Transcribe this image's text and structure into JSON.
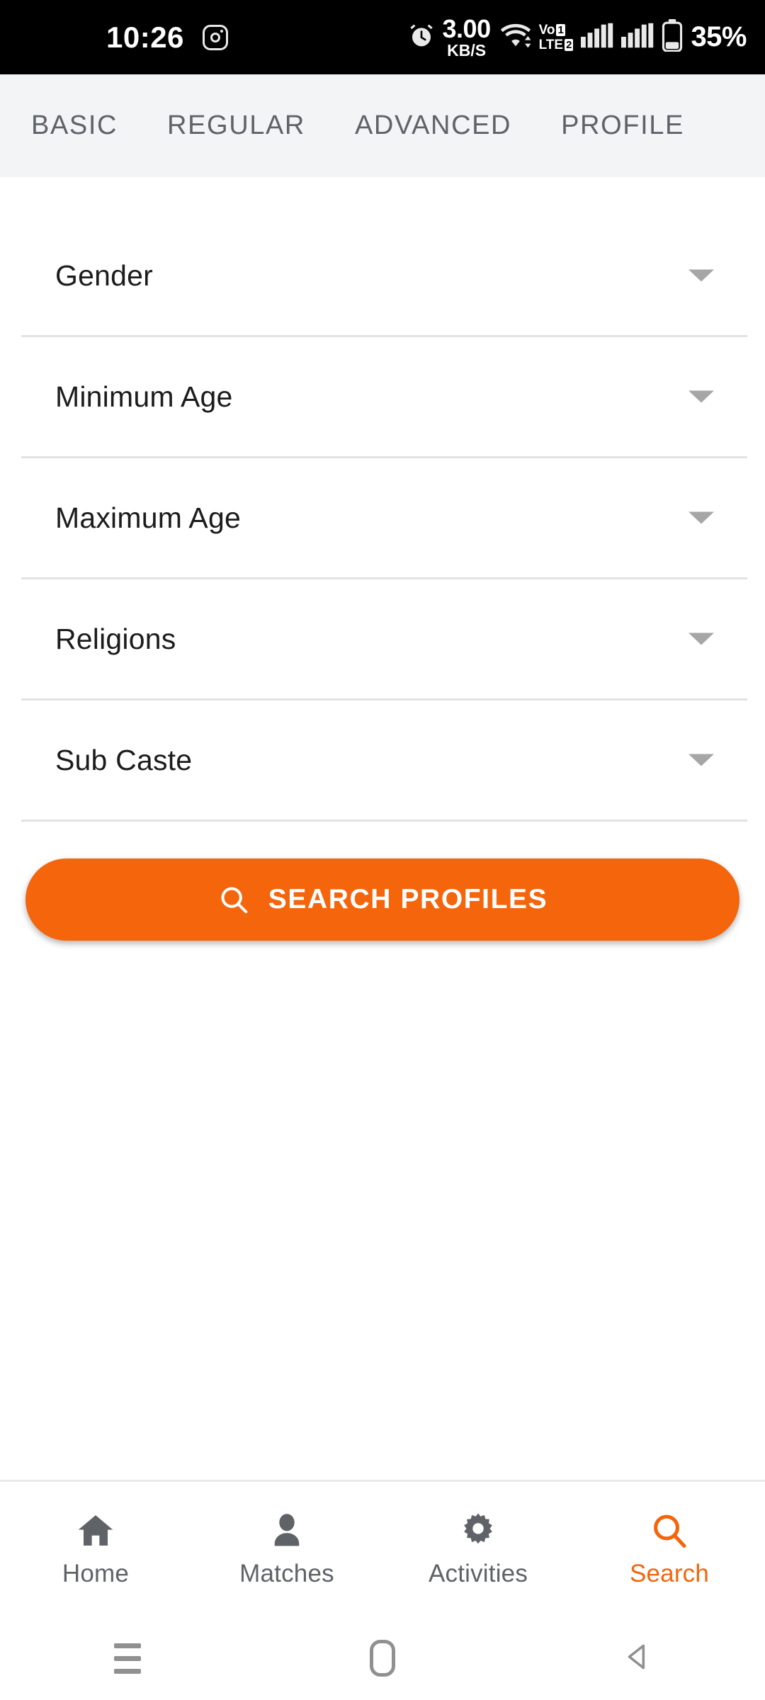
{
  "status_bar": {
    "time": "10:26",
    "app_icon": "instagram-icon",
    "alarm_icon": "alarm-clock-icon",
    "network_speed": "3.00",
    "network_speed_unit": "KB/S",
    "wifi_icon": "wifi-icon",
    "volte_label_top": "Vo",
    "volte_label_bottom": "LTE",
    "volte_sim1": "1",
    "volte_sim2": "2",
    "signal_icon": "cellular-signal-icon",
    "battery_icon": "battery-icon",
    "battery_level": "35%"
  },
  "tabs": [
    {
      "label": "BASIC",
      "active": true
    },
    {
      "label": "REGULAR",
      "active": false
    },
    {
      "label": "ADVANCED",
      "active": false
    },
    {
      "label": "PROFILE",
      "active": false
    }
  ],
  "form": {
    "fields": [
      {
        "label": "Gender",
        "value": "",
        "arrow_icon": "chevron-down-icon"
      },
      {
        "label": "Minimum Age",
        "value": "",
        "arrow_icon": "chevron-down-icon"
      },
      {
        "label": "Maximum Age",
        "value": "",
        "arrow_icon": "chevron-down-icon"
      },
      {
        "label": "Religions",
        "value": "",
        "arrow_icon": "chevron-down-icon"
      },
      {
        "label": "Sub Caste",
        "value": "",
        "arrow_icon": "chevron-down-icon"
      }
    ]
  },
  "search_button": {
    "label": "SEARCH PROFILES",
    "icon": "search-icon",
    "background_color": "#f4650c",
    "text_color": "#ffffff"
  },
  "bottom_nav": {
    "items": [
      {
        "label": "Home",
        "icon": "home-icon",
        "active": false
      },
      {
        "label": "Matches",
        "icon": "person-icon",
        "active": false
      },
      {
        "label": "Activities",
        "icon": "gear-icon",
        "active": false
      },
      {
        "label": "Search",
        "icon": "search-icon",
        "active": true
      }
    ],
    "active_color": "#f4650c",
    "inactive_color": "#5f6368"
  },
  "system_nav": {
    "recents": "recents-icon",
    "home": "home-pill-icon",
    "back": "back-icon"
  },
  "theme": {
    "accent": "#f4650c",
    "tab_bar_bg": "#f2f4f6",
    "divider": "#e2e2e2",
    "text_primary": "#1c1c1c",
    "text_secondary": "#5f6368"
  }
}
